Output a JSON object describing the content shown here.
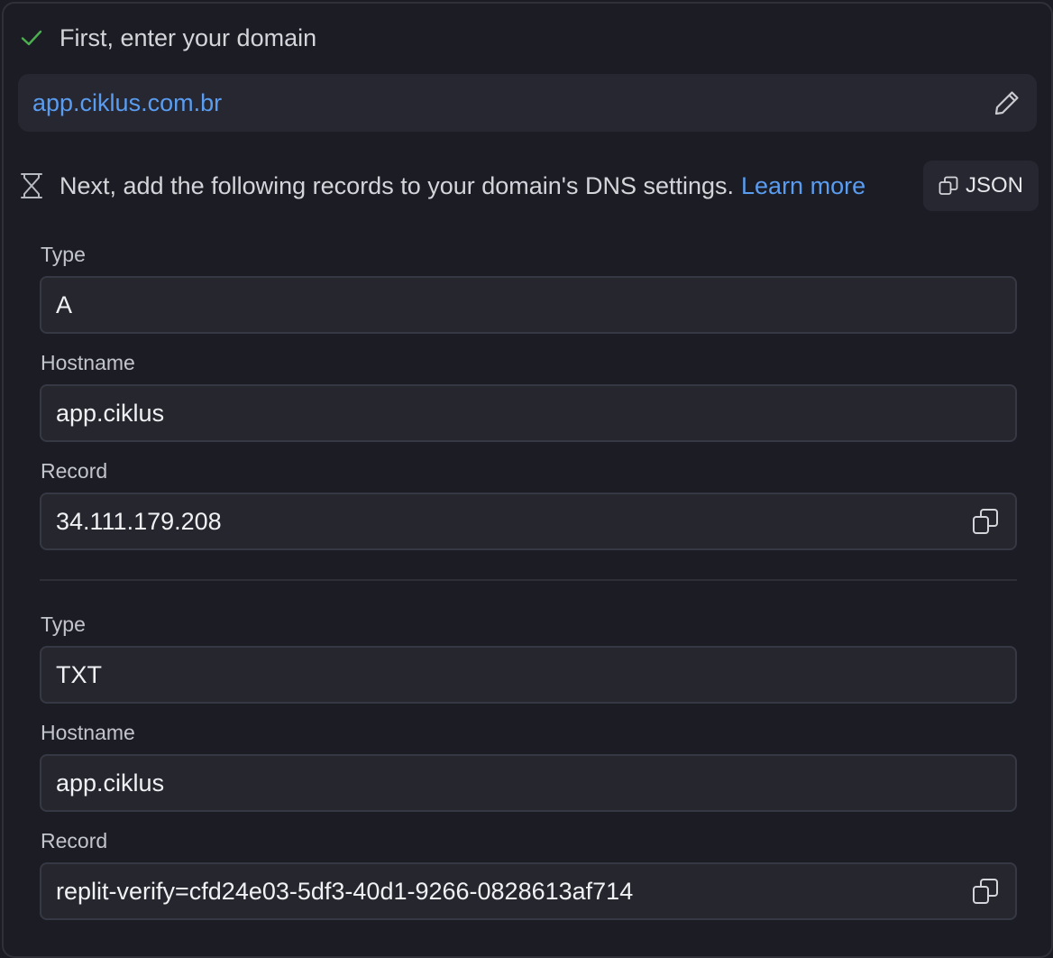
{
  "step1": {
    "text": "First, enter your domain",
    "icon": "check-icon",
    "status_color": "#4caf50"
  },
  "domain": {
    "value": "app.ciklus.com.br",
    "edit_icon": "pencil-icon"
  },
  "step2": {
    "text": "Next, add the following records to your domain's DNS settings.",
    "link_text": "Learn more",
    "icon": "hourglass-icon"
  },
  "json_button": {
    "label": "JSON",
    "icon": "copy-icon"
  },
  "records": [
    {
      "type_label": "Type",
      "type_value": "A",
      "hostname_label": "Hostname",
      "hostname_value": "app.ciklus",
      "record_label": "Record",
      "record_value": "34.111.179.208"
    },
    {
      "type_label": "Type",
      "type_value": "TXT",
      "hostname_label": "Hostname",
      "hostname_value": "app.ciklus",
      "record_label": "Record",
      "record_value": "replit-verify=cfd24e03-5df3-40d1-9266-0828613af714"
    }
  ],
  "colors": {
    "accent": "#5a9cf0",
    "background": "#1c1d24",
    "field_background": "#25262e"
  }
}
